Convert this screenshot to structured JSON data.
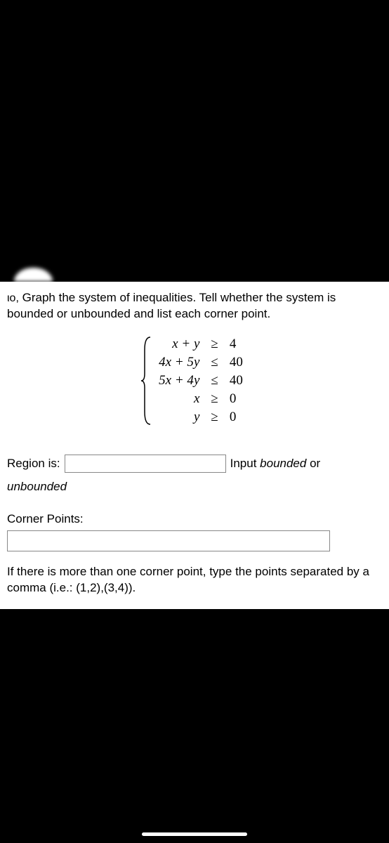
{
  "question": {
    "prefix": "ιο,",
    "text": "Graph the system of inequalities. Tell whether the system is bounded or unbounded and list each corner point."
  },
  "inequalities": [
    {
      "lhs": "x + y",
      "op": "≥",
      "rhs": "4"
    },
    {
      "lhs": "4x + 5y",
      "op": "≤",
      "rhs": "40"
    },
    {
      "lhs": "5x + 4y",
      "op": "≤",
      "rhs": "40"
    },
    {
      "lhs": "x",
      "op": "≥",
      "rhs": "0"
    },
    {
      "lhs": "y",
      "op": "≥",
      "rhs": "0"
    }
  ],
  "region": {
    "label": "Region is:",
    "value": "",
    "hint_prefix": "Input ",
    "hint_italic": "bounded",
    "hint_suffix": " or",
    "hint_line2": "unbounded"
  },
  "corner": {
    "label": "Corner Points:",
    "value": ""
  },
  "instruction": "If there is more than one corner point, type the points separated by a comma (i.e.: (1,2),(3,4))."
}
